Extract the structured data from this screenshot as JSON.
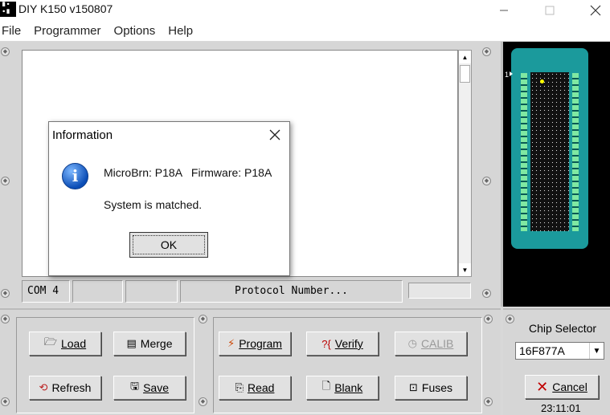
{
  "window": {
    "title": "DIY K150 v150807",
    "icon_text": "∎∙ ∙∎",
    "minimize_icon": "minimize-icon",
    "maximize_icon": "maximize-icon",
    "close_icon": "close-icon"
  },
  "menu": {
    "items": [
      "File",
      "Programmer",
      "Options",
      "Help"
    ]
  },
  "status": {
    "com_port": "COM 4",
    "blank1": "",
    "blank2": "",
    "protocol": "Protocol Number...",
    "progress_value": 0
  },
  "chip": {
    "pin1_label": "1"
  },
  "buttons": {
    "load": "Load",
    "merge": "Merge",
    "refresh": "Refresh",
    "save": "Save",
    "program": "Program",
    "verify": "Verify",
    "calib": "CALIB",
    "read": "Read",
    "blank": "Blank",
    "fuses": "Fuses"
  },
  "chip_selector": {
    "label": "Chip Selector",
    "selected": "16F877A",
    "cancel": "Cancel",
    "clock": "23:11:01"
  },
  "dialog": {
    "title": "Information",
    "line1": "MicroBrn: P18A   Firmware: P18A",
    "line2": "System is matched.",
    "ok": "OK",
    "icon": "information-icon"
  },
  "colors": {
    "chip_body": "#1b9a9c",
    "chip_pins": "#7fe8a2",
    "cancel_accent": "#c00000",
    "info_icon": "#0b4db6"
  }
}
